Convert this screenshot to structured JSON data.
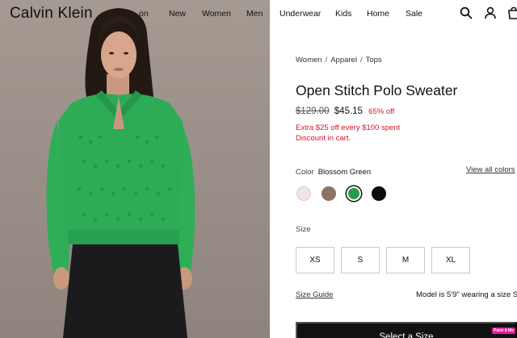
{
  "header": {
    "logo": "Calvin Klein",
    "nav": [
      "on",
      "New",
      "Women",
      "Men",
      "Underwear",
      "Kids",
      "Home",
      "Sale"
    ],
    "icons": [
      "search-icon",
      "account-icon",
      "bag-icon"
    ]
  },
  "breadcrumb": [
    "Women",
    "Apparel",
    "Tops"
  ],
  "product": {
    "title": "Open Stitch Polo Sweater",
    "original_price": "$129.00",
    "sale_price": "$45.15",
    "discount": "65% off",
    "promo_line1": "Extra $25 off every $100 spent",
    "promo_line2": "Discount in cart."
  },
  "color": {
    "label": "Color",
    "selected": "Blossom Green",
    "view_all": "View all colors",
    "swatches": [
      "#f1e5e2",
      "#8b7463",
      "#2a9b4e",
      "#0d0d0d"
    ]
  },
  "size": {
    "label": "Size",
    "options": [
      "XS",
      "S",
      "M",
      "XL"
    ],
    "guide": "Size Guide",
    "model_info": "Model is 5'9\" wearing a size S"
  },
  "cta": {
    "label": "Select a Size"
  },
  "badge": "Paint it Me",
  "colors": {
    "accent_red": "#d7142b",
    "sweater_green": "#2dac55",
    "cta_black": "#111111"
  }
}
